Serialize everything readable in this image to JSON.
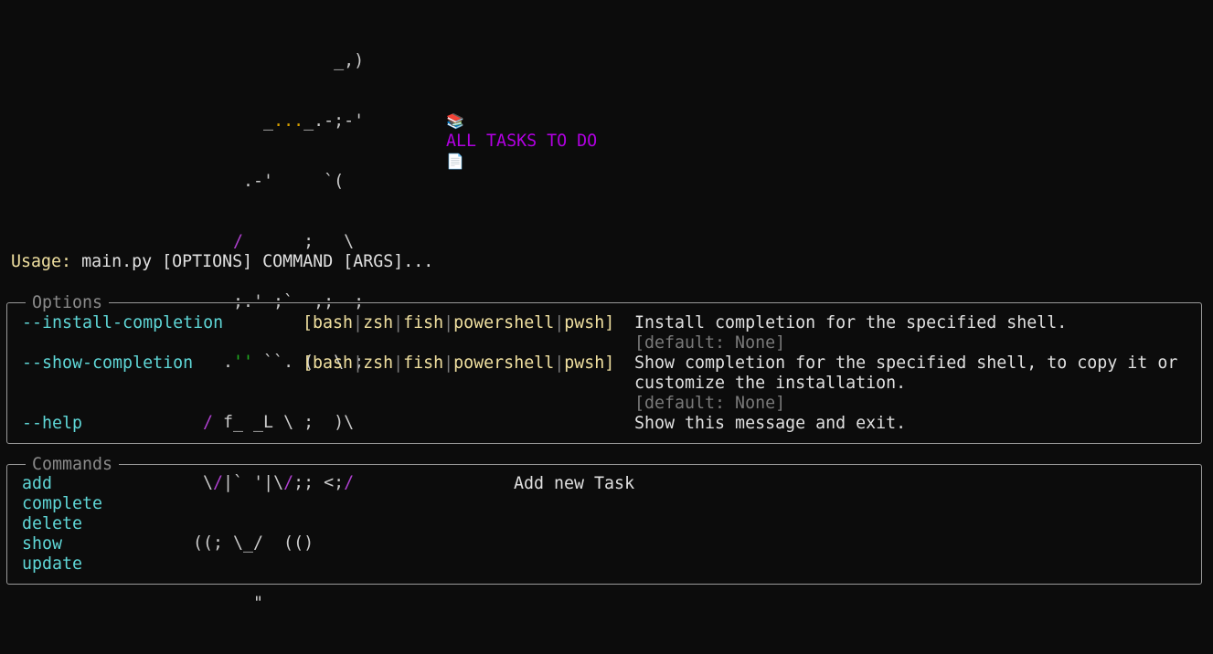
{
  "ascii_art": {
    "line1": "               _,)",
    "line2a": "        _",
    "line2b": "...",
    "line2c": "_.-;-'",
    "line3": "      .-'     `(",
    "line4a": "     ",
    "line4b": "/",
    "line4c": "      ;   \\",
    "line5": "     ;.' ;`  ,;  ;",
    "line6a": "    .",
    "line6b": "''",
    "line6c": " ``. (  \\ ;",
    "line7a": "  ",
    "line7b": "/",
    "line7c": " f_ _L \\ ;  )\\",
    "line8a": "  \\",
    "line8b": "/",
    "line8c": "|` '|\\",
    "line8d": "/",
    "line8e": ";; <;",
    "line8f": "/",
    "line9": " ((; \\_/  (()",
    "line10": "       \""
  },
  "title": {
    "emoji_left": "📚",
    "text": "ALL TASKS TO DO",
    "emoji_right": "📄"
  },
  "usage": {
    "label": "Usage:",
    "text": "main.py [OPTIONS] COMMAND [ARGS]..."
  },
  "options": {
    "title": "Options",
    "items": [
      {
        "flag": "--install-completion",
        "choices": [
          "bash",
          "zsh",
          "fish",
          "powershell",
          "pwsh"
        ],
        "desc_lines": [
          "Install completion for the specified shell."
        ],
        "default": "[default: None]"
      },
      {
        "flag": "--show-completion",
        "choices": [
          "bash",
          "zsh",
          "fish",
          "powershell",
          "pwsh"
        ],
        "desc_lines": [
          "Show completion for the specified shell, to copy it or",
          "customize the installation."
        ],
        "default": "[default: None]"
      },
      {
        "flag": "--help",
        "desc_lines": [
          "Show this message and exit."
        ]
      }
    ]
  },
  "commands": {
    "title": "Commands",
    "items": [
      {
        "name": "add",
        "desc": "Add new Task"
      },
      {
        "name": "complete"
      },
      {
        "name": "delete"
      },
      {
        "name": "show"
      },
      {
        "name": "update"
      }
    ]
  }
}
